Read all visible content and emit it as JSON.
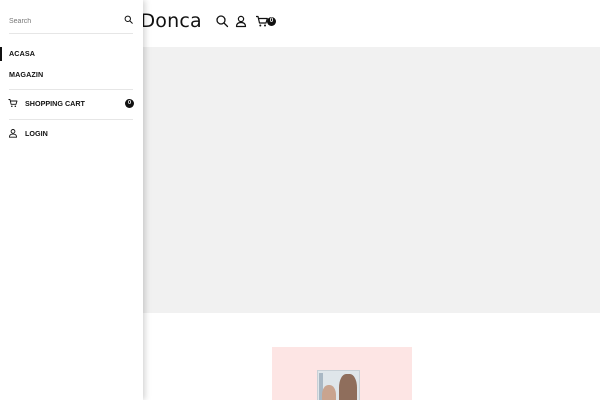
{
  "header": {
    "site_title": "n Donca",
    "cart_count": "0",
    "icons": [
      "search-icon",
      "user-icon",
      "cart-icon"
    ]
  },
  "mobile_menu": {
    "search": {
      "placeholder": "Search",
      "value": ""
    },
    "nav_items": [
      {
        "label": "ACASA",
        "active": true
      },
      {
        "label": "MAGAZIN",
        "active": false
      }
    ],
    "cart": {
      "label": "SHOPPING CART",
      "count": "0",
      "icon": "cart-icon"
    },
    "login": {
      "label": "LOGIN",
      "icon": "user-icon"
    }
  },
  "colors": {
    "text": "#111111",
    "hero_background": "#f1f1f1",
    "promo_background": "#fde5e4",
    "badge": "#111111"
  }
}
